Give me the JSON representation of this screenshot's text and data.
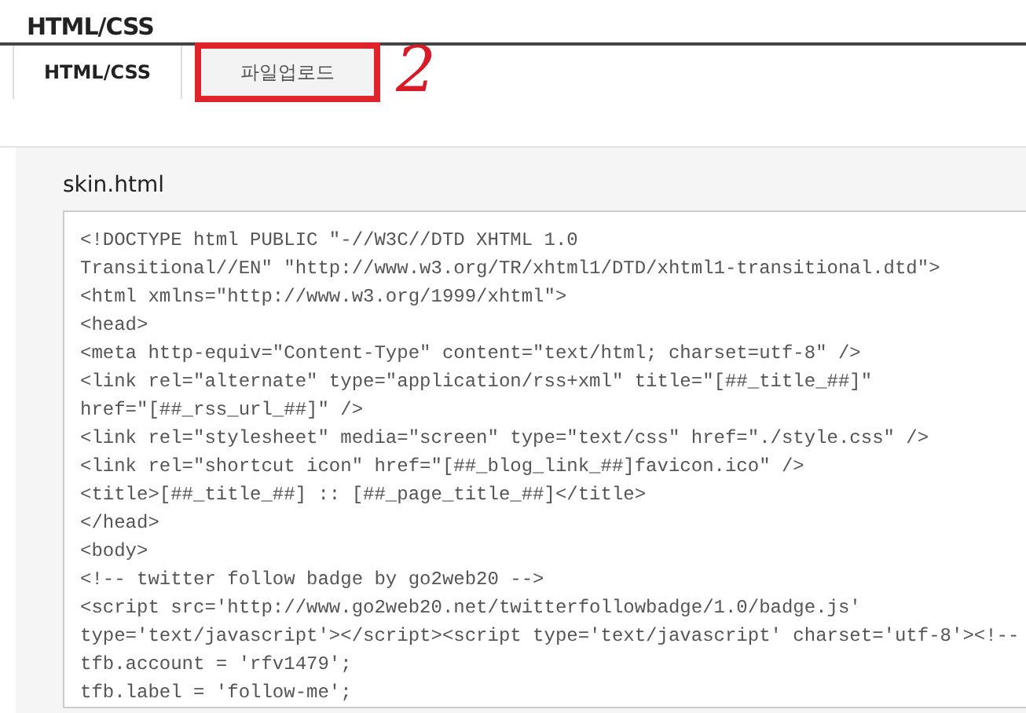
{
  "page_title": "HTML/CSS",
  "tabs": [
    {
      "label": "HTML/CSS",
      "selected": true,
      "highlighted": false
    },
    {
      "label": "파일업로드",
      "selected": false,
      "highlighted": true
    }
  ],
  "annotation": {
    "mark": "2"
  },
  "file": {
    "name": "skin.html",
    "lines": [
      "<!DOCTYPE html PUBLIC \"-//W3C//DTD XHTML 1.0",
      "Transitional//EN\" \"http://www.w3.org/TR/xhtml1/DTD/xhtml1-transitional.dtd\">",
      "<html xmlns=\"http://www.w3.org/1999/xhtml\">",
      "<head>",
      "<meta http-equiv=\"Content-Type\" content=\"text/html; charset=utf-8\" />",
      "<link rel=\"alternate\" type=\"application/rss+xml\" title=\"[##_title_##]\"",
      "href=\"[##_rss_url_##]\" />",
      "<link rel=\"stylesheet\" media=\"screen\" type=\"text/css\" href=\"./style.css\" />",
      "<link rel=\"shortcut icon\" href=\"[##_blog_link_##]favicon.ico\" />",
      "<title>[##_title_##] :: [##_page_title_##]</title>",
      "</head>",
      "<body>",
      "<!-- twitter follow badge by go2web20 -->",
      "<script src='http://www.go2web20.net/twitterfollowbadge/1.0/badge.js'",
      "type='text/javascript'></script><script type='text/javascript' charset='utf-8'><!--",
      "tfb.account = 'rfv1479';",
      "tfb.label = 'follow-me';"
    ]
  }
}
